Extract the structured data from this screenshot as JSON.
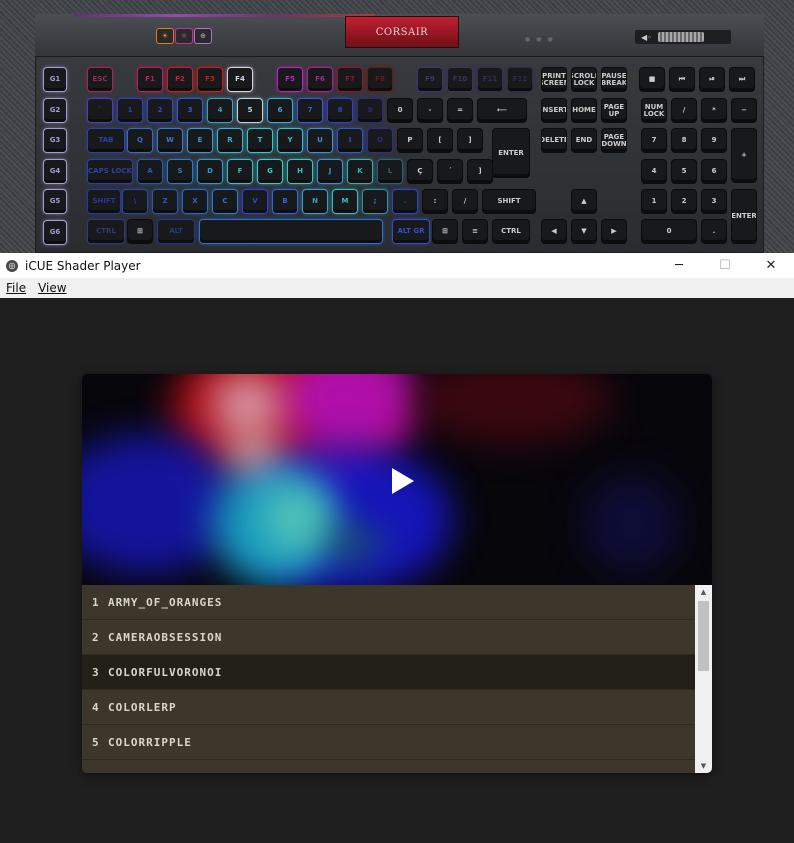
{
  "window": {
    "title": "iCUE Shader Player",
    "minimize_glyph": "─",
    "maximize_glyph": "☐",
    "close_glyph": "✕",
    "app_icon": "icue-icon"
  },
  "menu": {
    "file": "File",
    "view": "View"
  },
  "keyboard": {
    "brand": "CORSAIR",
    "profile_buttons": [
      "☀",
      "☼",
      "⊕"
    ],
    "keys": {
      "macro": [
        "G1",
        "G2",
        "G3",
        "G4",
        "G5",
        "G6"
      ],
      "row_f": [
        "ESC",
        "F1",
        "F2",
        "F3",
        "F4",
        "F5",
        "F6",
        "F7",
        "F8",
        "F9",
        "F10",
        "F11",
        "F12",
        "PRINT SCREEN",
        "SCROLL LOCK",
        "PAUSE BREAK"
      ],
      "row_num": [
        "`",
        "1",
        "2",
        "3",
        "4",
        "5",
        "6",
        "7",
        "8",
        "9",
        "0",
        "-",
        "=",
        "⟵",
        "INSERT",
        "HOME",
        "PAGE UP",
        "NUM LOCK",
        "/",
        "*",
        "−"
      ],
      "row_q": [
        "TAB",
        "Q",
        "W",
        "E",
        "R",
        "T",
        "Y",
        "U",
        "I",
        "O",
        "P",
        "[",
        "]",
        "ENTER",
        "DELETE",
        "END",
        "PAGE DOWN",
        "7",
        "8",
        "9",
        "+"
      ],
      "row_a": [
        "CAPS LOCK",
        "A",
        "S",
        "D",
        "F",
        "G",
        "H",
        "J",
        "K",
        "L",
        "Ç",
        "´",
        "]",
        "4",
        "5",
        "6"
      ],
      "row_z": [
        "SHIFT",
        "\\",
        "Z",
        "X",
        "C",
        "V",
        "B",
        "N",
        "M",
        ";",
        ".",
        ":",
        "/",
        "SHIFT",
        "▲",
        "1",
        "2",
        "3",
        "ENTER"
      ],
      "row_ctrl": [
        "CTRL",
        "⊞",
        "ALT",
        "",
        "ALT GR",
        "⊞",
        "≡",
        "CTRL",
        "◀",
        "▼",
        "▶",
        "0",
        "."
      ]
    },
    "media": [
      "■",
      "⏮",
      "⏯",
      "⏭"
    ],
    "volume_icon": "mute-icon"
  },
  "player": {
    "play_icon": "play-icon",
    "shaders": [
      {
        "num": "1",
        "name": "ARMY_OF_ORANGES",
        "selected": false
      },
      {
        "num": "2",
        "name": "CAMERAOBSESSION",
        "selected": false
      },
      {
        "num": "3",
        "name": "COLORFULVORONOI",
        "selected": true
      },
      {
        "num": "4",
        "name": "COLORLERP",
        "selected": false
      },
      {
        "num": "5",
        "name": "COLORRIPPLE",
        "selected": false
      }
    ],
    "scroll_up_glyph": "▲",
    "scroll_down_glyph": "▼"
  },
  "colors": {
    "list_bg": "#3c372a",
    "list_selected": "#232019",
    "app_bg": "#1f1f1f"
  }
}
